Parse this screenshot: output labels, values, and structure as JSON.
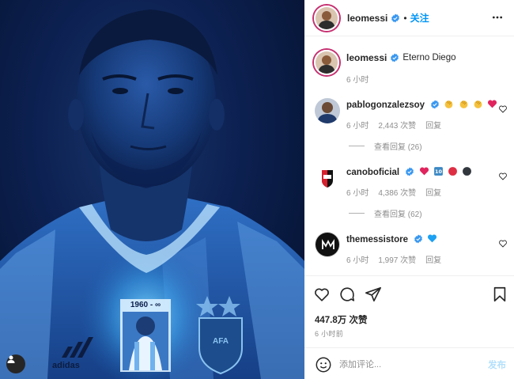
{
  "post": {
    "author": "leomessi",
    "follow_label": "关注",
    "dot": "•",
    "caption": "Eterno Diego",
    "caption_time": "6 小时",
    "likes": "447.8万 次赞",
    "time_ago": "6 小时前",
    "image_text": "1960 - ∞",
    "image_brand": "adidas",
    "image_badge": "AFA"
  },
  "comments": [
    {
      "username": "pablogonzalezsoy",
      "text": "👏👏👏❤️",
      "emoji": [
        "clapping-hands",
        "clapping-hands",
        "clapping-hands",
        "red-heart"
      ],
      "time": "6 小时",
      "likes": "2,443 次赞",
      "reply": "回复",
      "view_replies": "查看回复 (26)"
    },
    {
      "username": "canoboficial",
      "text": "❤️🔟🔴⚫",
      "emoji": [
        "red-heart",
        "keycap-ten",
        "red-circle",
        "black-circle"
      ],
      "time": "6 小时",
      "likes": "4,386 次赞",
      "reply": "回复",
      "view_replies": "查看回复 (62)"
    },
    {
      "username": "themessistore",
      "text": "💙",
      "emoji": [
        "blue-heart"
      ],
      "time": "6 小时",
      "likes": "1,997 次赞",
      "reply": "回复"
    }
  ],
  "composer": {
    "placeholder": "添加评论...",
    "post_label": "发布"
  },
  "icons": {
    "like": "heart-icon",
    "comment": "comment-icon",
    "share": "paper-plane-icon",
    "save": "bookmark-icon",
    "emoji": "smiley-icon",
    "more": "more-horizontal-icon",
    "verified": "verified-badge-icon",
    "tags": "user-tag-icon"
  },
  "colors": {
    "link": "#0095f6",
    "post_disabled": "#b2dffc",
    "verified": "#3897f0",
    "muted": "#8e8e8e",
    "image_bg": "#0c2050"
  }
}
